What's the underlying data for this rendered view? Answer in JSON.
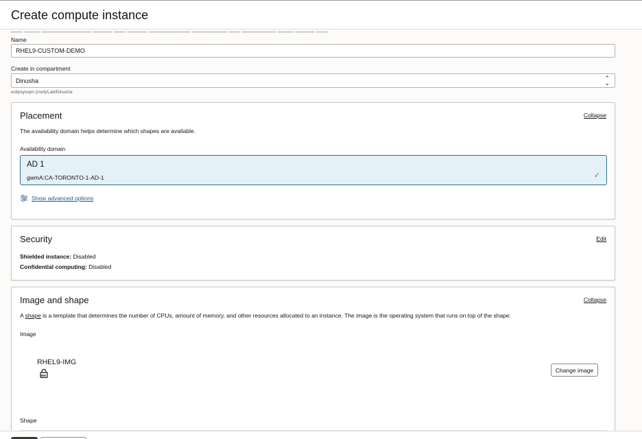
{
  "header": {
    "title": "Create compute instance"
  },
  "form": {
    "name_label": "Name",
    "name_value": "RHEL9-CUSTOM-DEMO",
    "compartment_label": "Create in compartment",
    "compartment_value": "Dinusha",
    "compartment_path": "eclipsysopn (root)/Lab/Dinusha"
  },
  "placement": {
    "title": "Placement",
    "collapse_label": "Collapse",
    "description": "The availability domain helps determine which shapes are available.",
    "ad_label": "Availability domain",
    "ad_title": "AD 1",
    "ad_subtitle": "gwmA:CA-TORONTO-1-AD-1",
    "advanced_link": "Show advanced options"
  },
  "security": {
    "title": "Security",
    "edit_label": "Edit",
    "shielded_label": "Shielded instance:",
    "shielded_value": "Disabled",
    "confidential_label": "Confidential computing:",
    "confidential_value": "Disabled"
  },
  "image_shape": {
    "title": "Image and shape",
    "collapse_label": "Collapse",
    "desc_before": "A ",
    "desc_link": "shape",
    "desc_after": " is a template that determines the number of CPUs, amount of memory, and other resources allocated to an instance. The image is the operating system that runs on top of the shape.",
    "image_label": "Image",
    "image_name": "RHEL9-IMG",
    "image_badge": "BM",
    "change_image_label": "Change image",
    "shape_label": "Shape"
  },
  "colors": {
    "accent_border": "#2e6f8e",
    "accent_fill": "#e4f1f7",
    "link": "#1f5a8e"
  },
  "icons": [
    "sliders-icon",
    "checkmark-icon",
    "lock-icon",
    "chevron-updown-icon"
  ]
}
